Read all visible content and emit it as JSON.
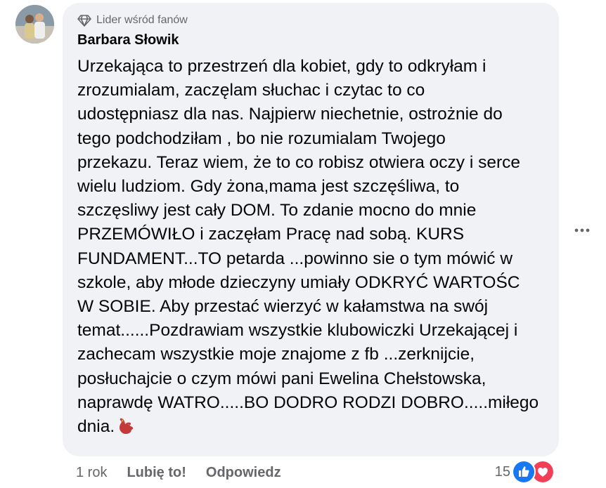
{
  "comment": {
    "badge_icon": "diamond-icon",
    "badge_label": "Lider wśród fanów",
    "author": "Barbara Słowik",
    "text": "Urzekająca to przestrzeń dla kobiet, gdy to odkryłam i\nzrozumialam, zaczęlam słuchac i czytac to co\nudostępniasz dla nas. Najpierw niechetnie, ostrożnie do\ntego podchodziłam , bo nie rozumialam Twojego\nprzekazu. Teraz wiem, że to co robisz otwiera oczy i serce\nwielu ludziom. Gdy żona,mama jest szczęśliwa, to\nszczęsliwy jest cały DOM. To zdanie mocno do mnie\nPRZEMÓWIŁO i zaczęłam Pracę nad sobą. KURS\nFUNDAMENT...TO petarda ...powinno sie o tym mówić w\nszkole, aby młode dzieczyny umiały ODKRYĆ WARTOŚC\nW SOBIE. Aby przestać wierzyć w kałamstwa na swój\ntemat......Pozdrawiam wszystkie klubowiczki Urzekającej i\nzachecam wszystkie moje znajome z fb ...zerknijcie,\nposłuchajcie o czym mówi pani Ewelina Chełstowska,\nnaprawdę WATRO.....BO DODRO RODZI DOBRO.....miłego\ndnia.",
    "trailing_emoji": "heart-hands-emoji"
  },
  "actions": {
    "time": "1 rok",
    "like": "Lubię to!",
    "reply": "Odpowiedz"
  },
  "reactions": {
    "count": "15",
    "icons": [
      "like-reaction-icon",
      "love-reaction-icon"
    ]
  },
  "colors": {
    "bubble_bg": "#f0f2f5",
    "secondary_text": "#65676b",
    "like_blue": "#1877f2",
    "love_red": "#f33e58"
  }
}
